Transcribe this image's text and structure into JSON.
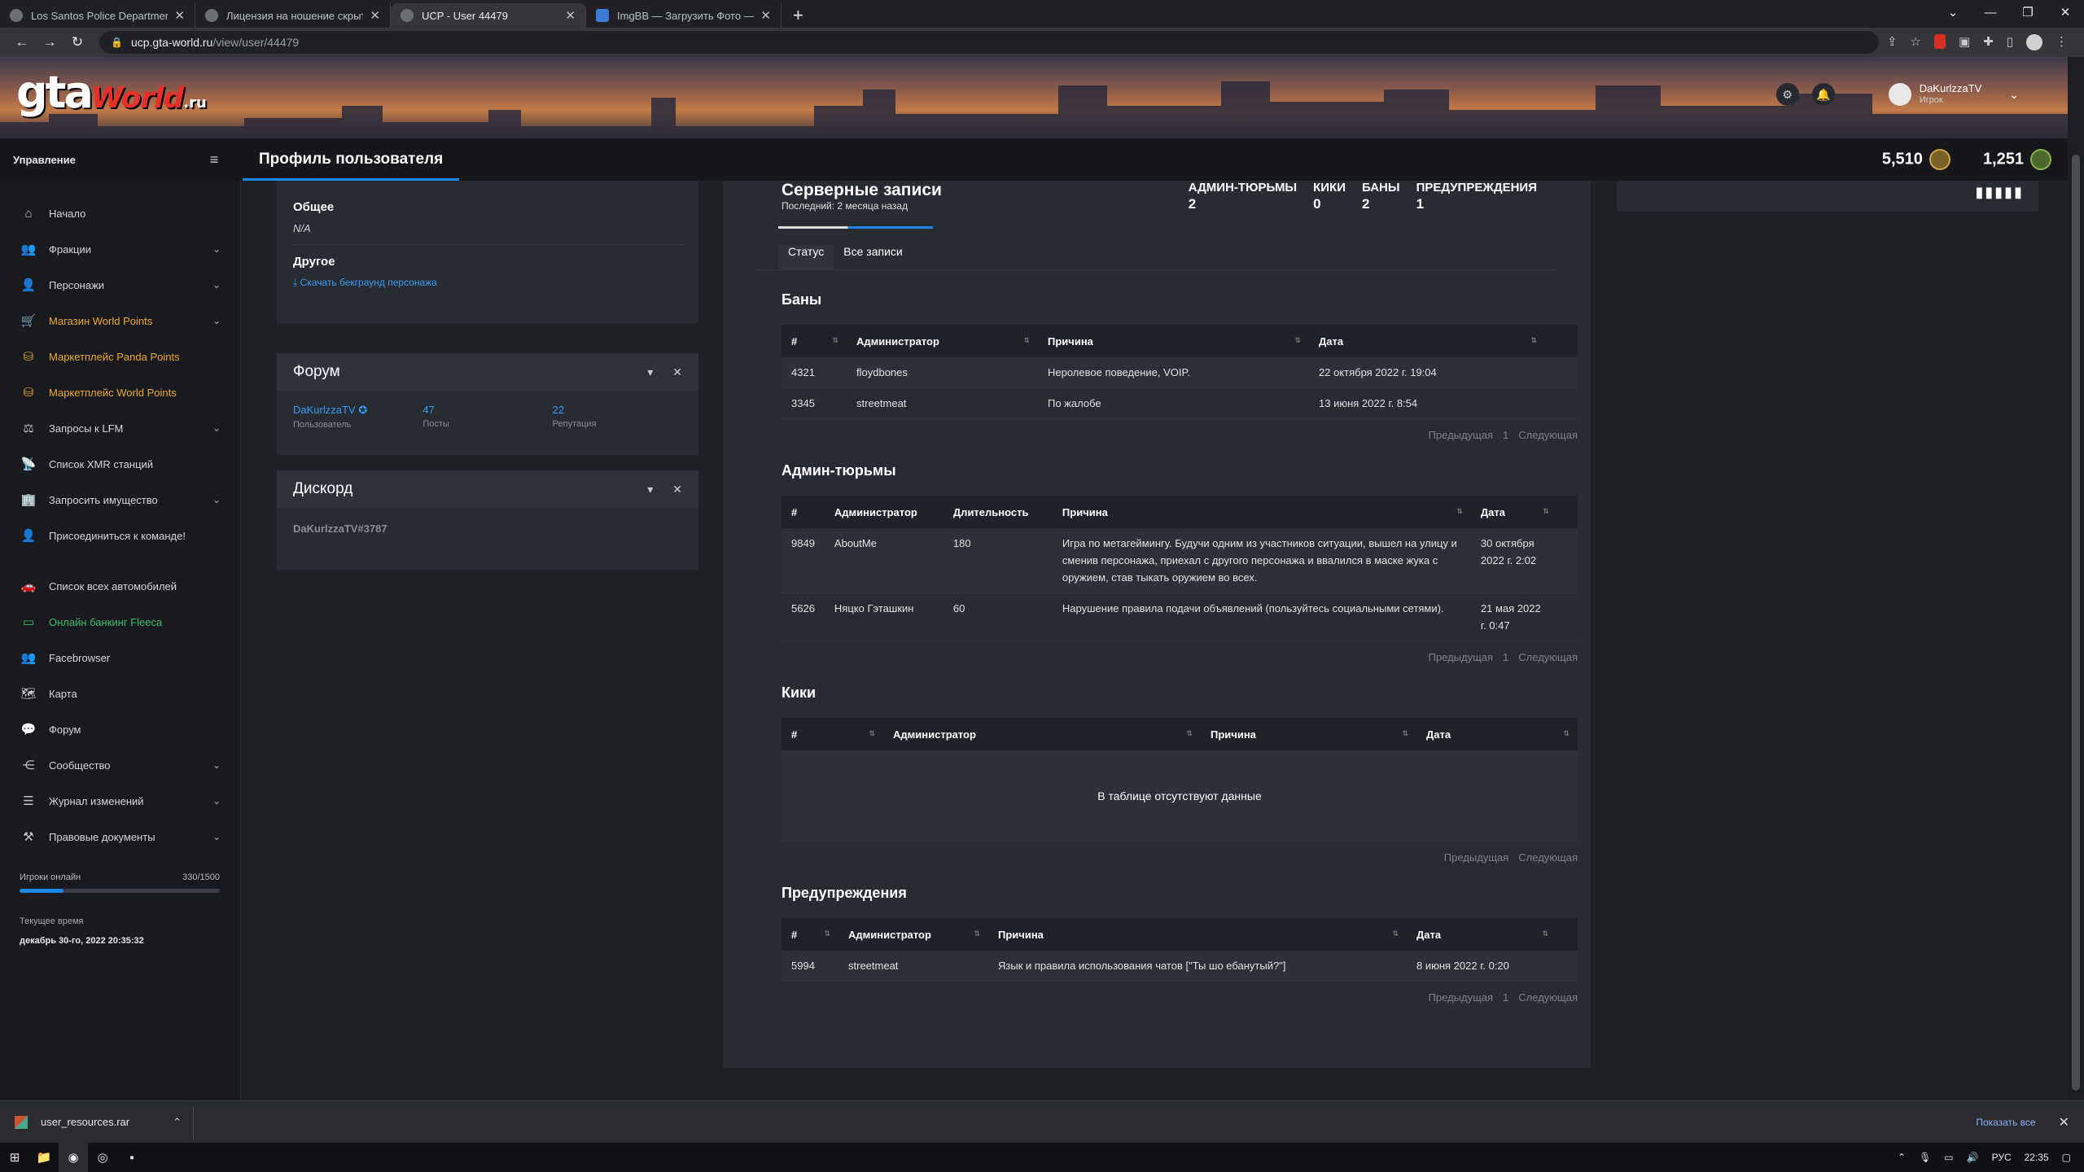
{
  "browser": {
    "tabs": [
      {
        "title": "Los Santos Police Department - I"
      },
      {
        "title": "Лицензия на ношение скрытог"
      },
      {
        "title": "UCP - User 44479"
      },
      {
        "title": "ImgBB — Загрузить Фото — Хо"
      }
    ],
    "url_host": "ucp.gta-world.ru",
    "url_path": "/view/user/44479"
  },
  "header": {
    "logo_gta": "gta",
    "logo_world": "World",
    "logo_ru": ".ru",
    "user_name": "DaKurlzzaTV",
    "user_role": "Игрок"
  },
  "topnav": {
    "management": "Управление",
    "page_title": "Профиль пользователя",
    "coins_a": "5,510",
    "coins_b": "1,251"
  },
  "sidebar": {
    "items": [
      {
        "label": "Начало",
        "icon": "home-icon"
      },
      {
        "label": "Фракции",
        "icon": "users-icon"
      },
      {
        "label": "Персонажи",
        "icon": "user-icon"
      },
      {
        "label": "Магазин World Points",
        "icon": "cart-icon"
      },
      {
        "label": "Маркетплейс Panda Points",
        "icon": "coins-icon"
      },
      {
        "label": "Маркетплейс World Points",
        "icon": "coins-icon"
      },
      {
        "label": "Запросы к LFM",
        "icon": "scale-icon"
      },
      {
        "label": "Список XMR станций",
        "icon": "antenna-icon"
      },
      {
        "label": "Запросить имущество",
        "icon": "building-icon"
      },
      {
        "label": "Присоединиться к команде!",
        "icon": "user-plus-icon"
      },
      {
        "label": "Список всех автомобилей",
        "icon": "car-icon"
      },
      {
        "label": "Онлайн банкинг Fleeca",
        "icon": "money-icon"
      },
      {
        "label": "Facebrowser",
        "icon": "users-icon"
      },
      {
        "label": "Карта",
        "icon": "map-icon"
      },
      {
        "label": "Форум",
        "icon": "comments-icon"
      },
      {
        "label": "Сообщество",
        "icon": "share-icon"
      },
      {
        "label": "Журнал изменений",
        "icon": "list-icon"
      },
      {
        "label": "Правовые документы",
        "icon": "gavel-icon"
      }
    ],
    "online_label": "Игроки онлайн",
    "online_value": "330/1500",
    "online_fraction": 0.22,
    "time_label": "Текущее время",
    "time_value": "декабрь 30-го, 2022 20:35:32"
  },
  "general": {
    "general_label": "Общее",
    "general_value": "N/A",
    "other_label": "Другое",
    "background_link": "Скачать бекграунд персонажа"
  },
  "forum": {
    "title": "Форум",
    "username": "DaKurlzzaTV",
    "username_key": "Пользователь",
    "posts": "47",
    "posts_key": "Посты",
    "rep": "22",
    "rep_key": "Репутация"
  },
  "discord": {
    "title": "Дискорд",
    "tag": "DaKurlzzaTV#3787"
  },
  "records": {
    "title": "Серверные записи",
    "subtitle": "Последний: 2 месяца назад",
    "counts": [
      {
        "label": "АДМИН-ТЮРЬМЫ",
        "value": "2"
      },
      {
        "label": "КИКИ",
        "value": "0"
      },
      {
        "label": "БАНЫ",
        "value": "2"
      },
      {
        "label": "ПРЕДУПРЕЖДЕНИЯ",
        "value": "1"
      }
    ],
    "tab_status": "Статус",
    "tab_all": "Все записи"
  },
  "pager": {
    "prev": "Предыдущая",
    "page": "1",
    "next": "Следующая"
  },
  "bans": {
    "title": "Баны",
    "headers": [
      "#",
      "Администратор",
      "Причина",
      "Дата"
    ],
    "rows": [
      [
        "4321",
        "floydbones",
        "Неролевое поведение, VOIP.",
        "22 октября 2022 г. 19:04"
      ],
      [
        "3345",
        "streetmeat",
        "По жалобе",
        "13 июня 2022 г. 8:54"
      ]
    ]
  },
  "jails": {
    "title": "Админ-тюрьмы",
    "headers": [
      "#",
      "Администратор",
      "Длительность",
      "Причина",
      "Дата"
    ],
    "rows": [
      [
        "9849",
        "AboutMe",
        "180",
        "Игра по метагеймингу. Будучи одним из участников ситуации, вышел на улицу и сменив персонажа, приехал с другого персонажа и ввалился в маске жука с оружием, став тыкать оружием во всех.",
        "30 октября 2022 г. 2:02"
      ],
      [
        "5626",
        "Няцко Гэташкин",
        "60",
        "Нарушение правила подачи объявлений (пользуйтесь социальными сетями).",
        "21 мая 2022 г. 0:47"
      ]
    ]
  },
  "kicks": {
    "title": "Кики",
    "headers": [
      "#",
      "Администратор",
      "Причина",
      "Дата"
    ],
    "empty": "В таблице отсутствуют данные"
  },
  "warnings": {
    "title": "Предупреждения",
    "headers": [
      "#",
      "Администратор",
      "Причина",
      "Дата"
    ],
    "rows": [
      [
        "5994",
        "streetmeat",
        "Язык и правила использования чатов [\"Ты шо ебанутый?\"]",
        "8 июня 2022 г. 0:20"
      ]
    ]
  },
  "download": {
    "file": "user_resources.rar",
    "show_all": "Показать все"
  },
  "taskbar": {
    "lang": "РУС",
    "clock": "22:35"
  }
}
